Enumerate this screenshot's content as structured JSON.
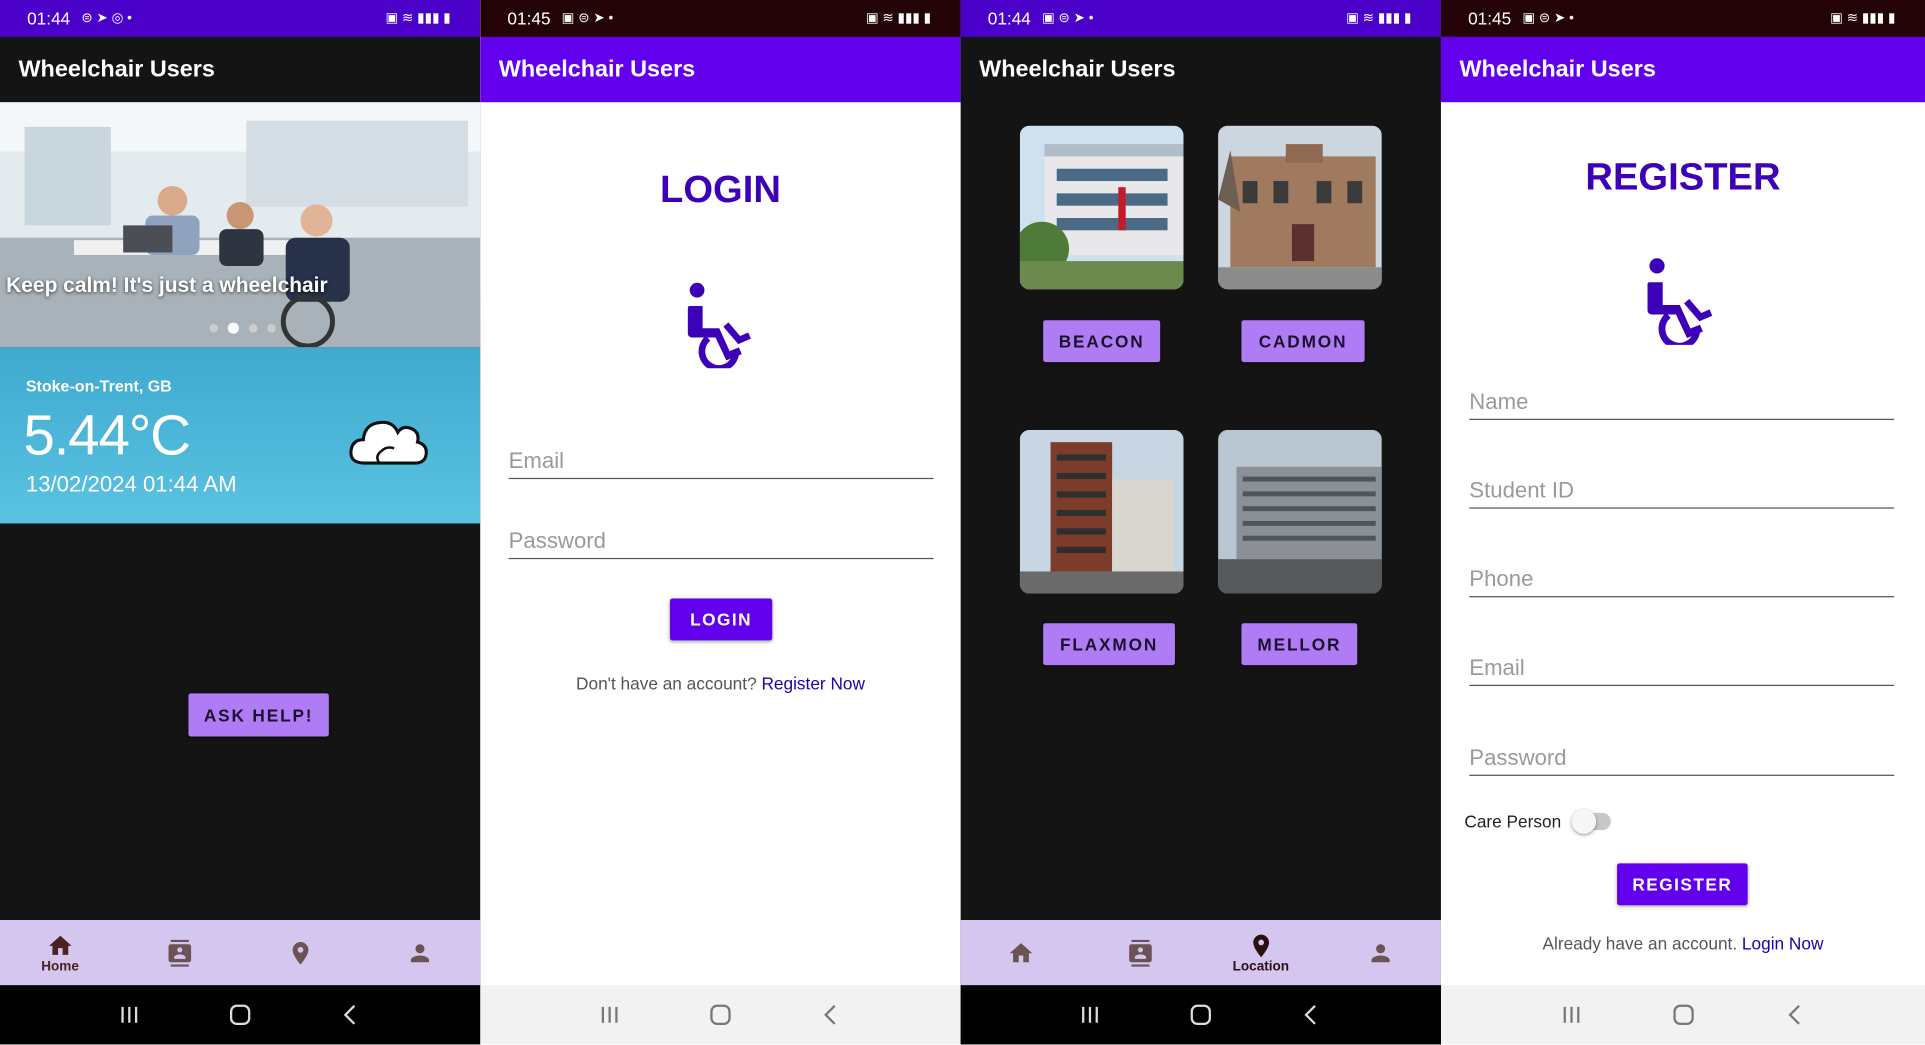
{
  "app": {
    "title": "Wheelchair Users"
  },
  "screens": [
    {
      "status_time": "01:44",
      "hero": {
        "caption": "Keep calm! It's just a wheelchair"
      },
      "weather": {
        "city": "Stoke-on-Trent, GB",
        "temperature": "5.44°C",
        "datetime": "13/02/2024 01:44 AM",
        "icon": "cloud-icon"
      },
      "ask_help_label": "ASK HELP!",
      "bottom_nav": [
        {
          "icon": "home-icon",
          "label": "Home",
          "active": true
        },
        {
          "icon": "contacts-icon",
          "label": "",
          "active": false
        },
        {
          "icon": "location-pin-icon",
          "label": "",
          "active": false
        },
        {
          "icon": "person-icon",
          "label": "",
          "active": false
        }
      ]
    },
    {
      "status_time": "01:45",
      "title": "LOGIN",
      "email_placeholder": "Email",
      "password_placeholder": "Password",
      "login_button": "LOGIN",
      "footer_text": "Don't have an account?",
      "footer_link": "Register Now"
    },
    {
      "status_time": "01:44",
      "locations": [
        {
          "name": "BEACON"
        },
        {
          "name": "CADMON"
        },
        {
          "name": "FLAXMON"
        },
        {
          "name": "MELLOR"
        }
      ],
      "bottom_nav": [
        {
          "icon": "home-icon",
          "label": "",
          "active": false
        },
        {
          "icon": "contacts-icon",
          "label": "",
          "active": false
        },
        {
          "icon": "location-pin-icon",
          "label": "Location",
          "active": true
        },
        {
          "icon": "person-icon",
          "label": "",
          "active": false
        }
      ]
    },
    {
      "status_time": "01:45",
      "title": "REGISTER",
      "fields": [
        "Name",
        "Student ID",
        "Phone",
        "Email",
        "Password"
      ],
      "toggle_label": "Care Person",
      "toggle_on": false,
      "register_button": "REGISTER",
      "footer_text": "Already have an account.",
      "footer_link": "Login Now"
    }
  ],
  "colors": {
    "primary": "#6200ee",
    "accent": "#b07cf6",
    "title": "#3b00b8",
    "nav_bg": "#d4c6ee"
  }
}
